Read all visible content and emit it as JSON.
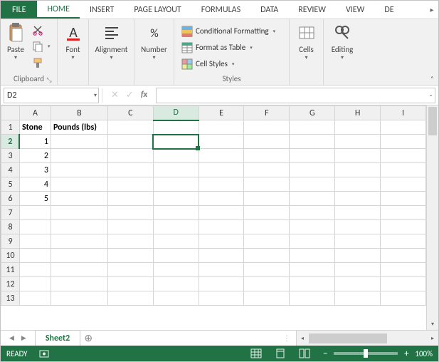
{
  "tabs": {
    "file": "FILE",
    "home": "HOME",
    "insert": "INSERT",
    "page_layout": "PAGE LAYOUT",
    "formulas": "FORMULAS",
    "data": "DATA",
    "review": "REVIEW",
    "view": "VIEW",
    "overflow": "DE"
  },
  "ribbon": {
    "clipboard": {
      "label": "Clipboard",
      "paste": "Paste"
    },
    "font": {
      "label": "Font"
    },
    "alignment": {
      "label": "Alignment"
    },
    "number": {
      "label": "Number"
    },
    "styles": {
      "label": "Styles",
      "conditional_formatting": "Conditional Formatting",
      "format_as_table": "Format as Table",
      "cell_styles": "Cell Styles"
    },
    "cells": {
      "label": "Cells"
    },
    "editing": {
      "label": "Editing"
    }
  },
  "namebox": {
    "value": "D2"
  },
  "formula_bar": {
    "value": ""
  },
  "grid": {
    "columns": [
      "A",
      "B",
      "C",
      "D",
      "E",
      "F",
      "G",
      "H",
      "I"
    ],
    "col_widths": {
      "A": "narrow",
      "B": "wide"
    },
    "active_col": "D",
    "active_row": 2,
    "rows": [
      1,
      2,
      3,
      4,
      5,
      6,
      7,
      8,
      9,
      10,
      11,
      12,
      13
    ],
    "data": {
      "A1": {
        "v": "Stone",
        "align": "left",
        "bold": true
      },
      "B1": {
        "v": "Pounds (lbs)",
        "align": "left",
        "bold": true
      },
      "A2": {
        "v": "1",
        "align": "right"
      },
      "A3": {
        "v": "2",
        "align": "right"
      },
      "A4": {
        "v": "3",
        "align": "right"
      },
      "A5": {
        "v": "4",
        "align": "right"
      },
      "A6": {
        "v": "5",
        "align": "right"
      }
    }
  },
  "sheet_tabs": {
    "active": "Sheet2"
  },
  "status": {
    "mode": "READY",
    "zoom": "100%"
  }
}
